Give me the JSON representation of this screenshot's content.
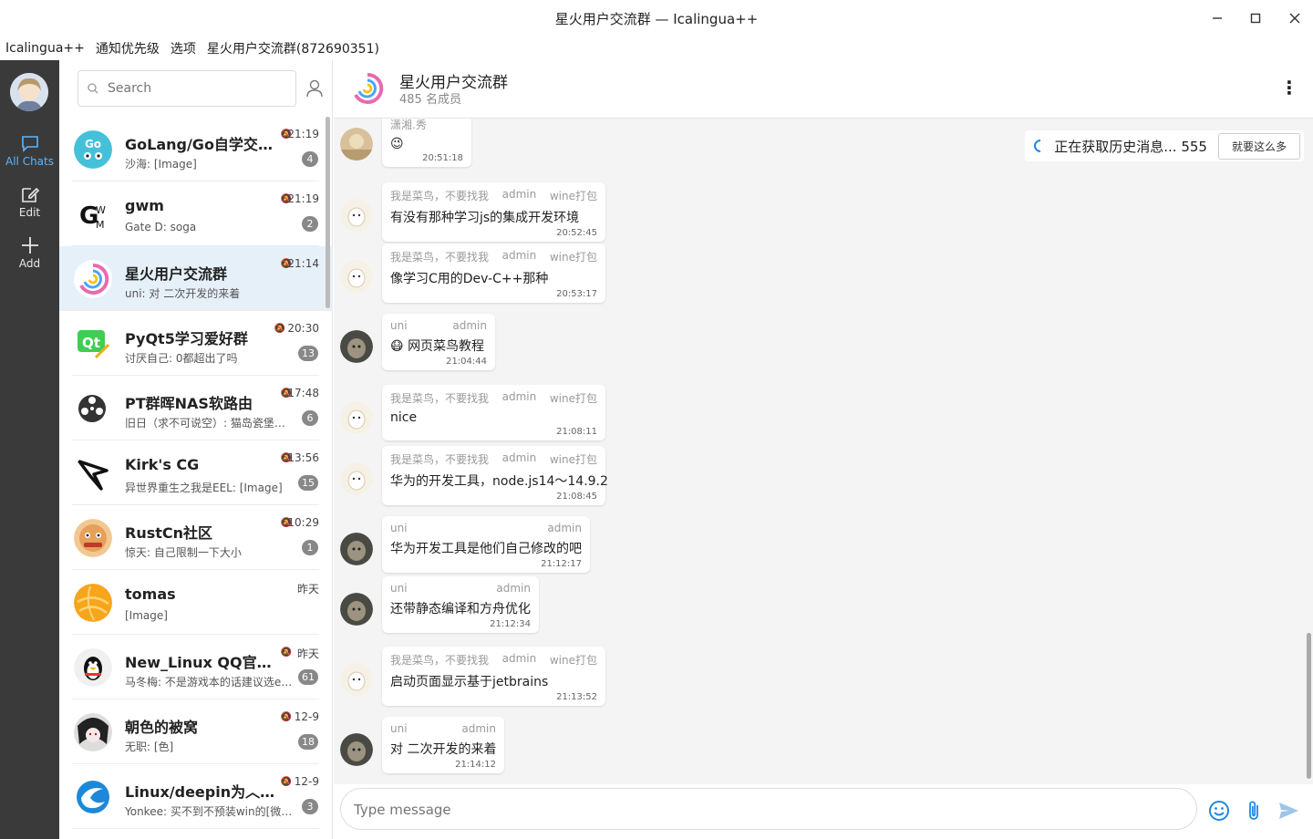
{
  "window": {
    "title": "星火用户交流群 — Icalingua++"
  },
  "menu": [
    "Icalingua++",
    "通知优先级",
    "选项",
    "星火用户交流群(872690351)"
  ],
  "nav": {
    "all_chats": "All Chats",
    "edit": "Edit",
    "add": "Add"
  },
  "search": {
    "placeholder": "Search"
  },
  "rooms": [
    {
      "name": "GoLang/Go自学交流群",
      "preview": "沙海: [Image]",
      "time": "21:19",
      "badge": "4",
      "muted": true
    },
    {
      "name": "gwm",
      "preview": "Gate D: soga",
      "time": "21:19",
      "badge": "2",
      "muted": true
    },
    {
      "name": "星火用户交流群",
      "preview": "uni: 对 二次开发的来着",
      "time": "21:14",
      "badge": "",
      "muted": true
    },
    {
      "name": "PyQt5学习爱好群",
      "preview": "讨厌自己: 0都超出了吗",
      "time": "20:30",
      "badge": "13",
      "muted": true
    },
    {
      "name": "PT群晖NAS软路由",
      "preview": "旧日（求不可说空）: 猫岛瓷堡都…",
      "time": "17:48",
      "badge": "6",
      "muted": true
    },
    {
      "name": "Kirk's CG",
      "preview": "异世界重生之我是EEL: [Image]",
      "time": "13:56",
      "badge": "15",
      "muted": true
    },
    {
      "name": "RustCn社区",
      "preview": "惊天: 自己限制一下大小",
      "time": "10:29",
      "badge": "1",
      "muted": true
    },
    {
      "name": "tomas",
      "preview": "[Image]",
      "time": "昨天",
      "badge": "",
      "muted": false
    },
    {
      "name": "New_Linux QQ官方…",
      "preview": "马冬梅: 不是游戏本的话建议选e…",
      "time": "昨天",
      "badge": "61",
      "muted": true
    },
    {
      "name": "朝色的被窝",
      "preview": "无职: [色]",
      "time": "12-9",
      "badge": "18",
      "muted": true
    },
    {
      "name": "Linux/deepin为︿悠…",
      "preview": "Yonkee: 买不到不预装win的[微慢]",
      "time": "12-9",
      "badge": "3",
      "muted": true
    }
  ],
  "chat": {
    "name": "星火用户交流群",
    "members": "485 名成员",
    "history": {
      "text": "正在获取历史消息... 555",
      "button": "就要这么多"
    },
    "messages": [
      {
        "sender": "潇湘.秀",
        "title": "",
        "badge": "",
        "text": "",
        "emoji": "😉",
        "time": "20:51:18"
      },
      {
        "sender": "我是菜鸟，不要找我",
        "title": "admin",
        "badge": "wine打包",
        "text": "有没有那种学习js的集成开发环境",
        "emoji": "",
        "time": "20:52:45"
      },
      {
        "sender": "我是菜鸟，不要找我",
        "title": "admin",
        "badge": "wine打包",
        "text": "像学习C用的Dev-C++那种",
        "emoji": "",
        "time": "20:53:17"
      },
      {
        "sender": "uni",
        "title": "admin",
        "badge": "",
        "text": "网页菜鸟教程",
        "emoji": "😷",
        "time": "21:04:44"
      },
      {
        "sender": "我是菜鸟，不要找我",
        "title": "admin",
        "badge": "wine打包",
        "text": "nice",
        "emoji": "",
        "time": "21:08:11"
      },
      {
        "sender": "我是菜鸟，不要找我",
        "title": "admin",
        "badge": "wine打包",
        "text": "华为的开发工具，node.js14～14.9.2",
        "emoji": "",
        "time": "21:08:45"
      },
      {
        "sender": "uni",
        "title": "admin",
        "badge": "",
        "text": "华为开发工具是他们自己修改的吧",
        "emoji": "",
        "time": "21:12:17"
      },
      {
        "sender": "uni",
        "title": "admin",
        "badge": "",
        "text": "还带静态编译和方舟优化",
        "emoji": "",
        "time": "21:12:34"
      },
      {
        "sender": "我是菜鸟，不要找我",
        "title": "admin",
        "badge": "wine打包",
        "text": "启动页面显示基于jetbrains",
        "emoji": "",
        "time": "21:13:52"
      },
      {
        "sender": "uni",
        "title": "admin",
        "badge": "",
        "text": "对 二次开发的来着",
        "emoji": "",
        "time": "21:14:12"
      }
    ]
  },
  "composer": {
    "placeholder": "Type message"
  },
  "colors": {
    "accent": "#1f88e5",
    "nav_bg": "#3a3a3a",
    "selected_row": "#e6f0f9",
    "chat_bg": "#f4f4f4"
  }
}
